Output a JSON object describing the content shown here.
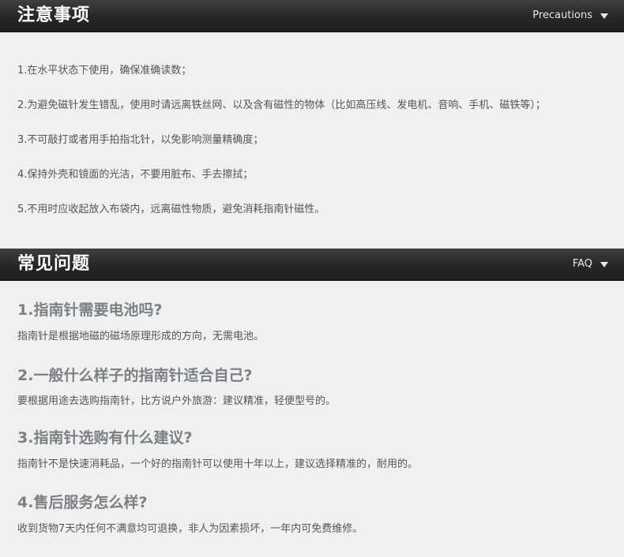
{
  "precautions": {
    "title": "注意事项",
    "tag": "Precautions",
    "items": [
      "1.在水平状态下使用，确保准确读数；",
      "2.为避免磁针发生错乱，使用时请远离铁丝网、以及含有磁性的物体（比如高压线、发电机、音响、手机、磁铁等）；",
      "3.不可敲打或者用手拍指北针，以免影响测量精确度；",
      "4.保持外壳和镜面的光洁，不要用脏布、手去擦拭；",
      "5.不用时应收起放入布袋内，远离磁性物质，避免消耗指南针磁性。"
    ]
  },
  "faq": {
    "title": "常见问题",
    "tag": "FAQ",
    "items": [
      {
        "q": "1.指南针需要电池吗?",
        "a": "指南针是根据地磁的磁场原理形成的方向，无需电池。"
      },
      {
        "q": "2.一般什么样子的指南针适合自己?",
        "a": "要根据用途去选购指南针，比方说户外旅游：建议精准，轻便型号的。"
      },
      {
        "q": "3.指南针选购有什么建议?",
        "a": "指南针不是快速消耗品，一个好的指南针可以使用十年以上，建议选择精准的，耐用的。"
      },
      {
        "q": "4.售后服务怎么样?",
        "a": "收到货物7天内任何不满意均可退换，非人为因素损坏，一年内可免费维修。"
      }
    ]
  }
}
